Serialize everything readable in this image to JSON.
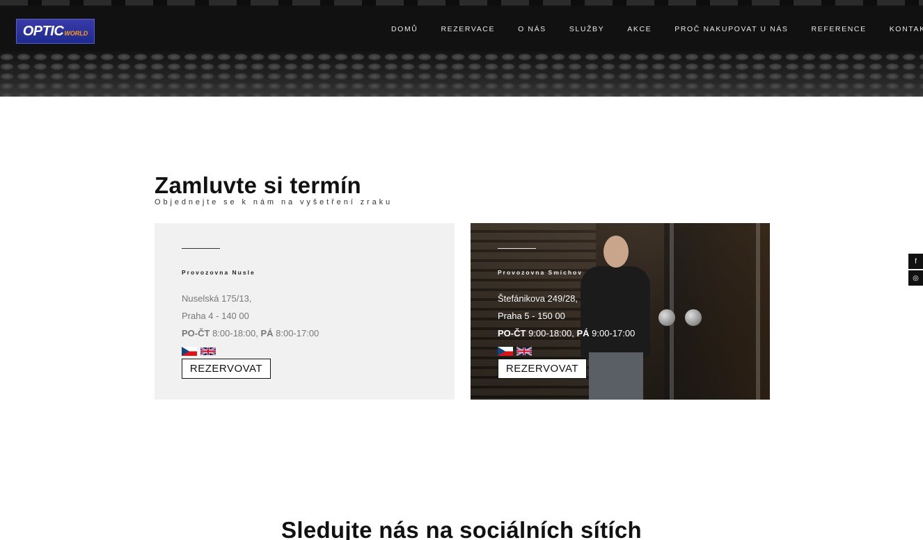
{
  "brand": {
    "logo_main": "OPTIC",
    "logo_sub": "WORLD"
  },
  "nav": {
    "items": [
      "DOMŮ",
      "REZERVACE",
      "O NÁS",
      "SLUŽBY",
      "AKCE",
      "PROČ NAKUPOVAT U NÁS",
      "REFERENCE",
      "KONTAKT"
    ],
    "language_flag": "uk-flag-icon"
  },
  "section": {
    "title": "Zamluvte si termín",
    "subtitle": "Objednejte se k nám na vyšetření zraku"
  },
  "cards": [
    {
      "label": "Provozovna Nusle",
      "address1": "Nuselská 175/13,",
      "address2": "Praha 4 - 140 00",
      "hours_prefix1": "PO-ČT",
      "hours1": " 8:00-18:00, ",
      "hours_prefix2": "PÁ",
      "hours2": " 8:00-17:00",
      "button": "REZERVOVAT"
    },
    {
      "label": "Provozovna Smíchov",
      "address1": "Štefánikova 249/28,",
      "address2": "Praha 5 - 150 00",
      "hours_prefix1": "PO-ČT",
      "hours1": " 9:00-18:00, ",
      "hours_prefix2": "PÁ",
      "hours2": " 9:00-17:00",
      "button": "REZERVOVAT"
    }
  ],
  "side_social": {
    "facebook": "f",
    "instagram": "◎"
  },
  "follow_title": "Sledujte nás na sociálních sítích",
  "colors": {
    "nav_bg": "#111111",
    "card_left_bg": "#f1f1f1",
    "logo_blue": "#2a34a0",
    "logo_orange": "#ff9a1a"
  }
}
